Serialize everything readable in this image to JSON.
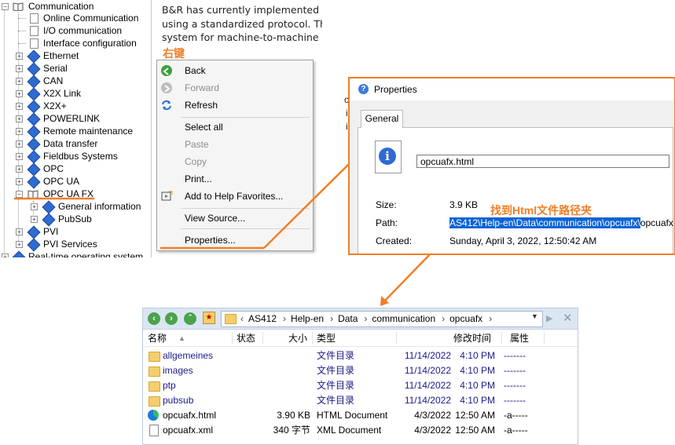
{
  "tree": {
    "root": "Communication",
    "items": [
      {
        "label": "Online Communication",
        "kind": "doc",
        "depth": 1
      },
      {
        "label": "I/O communication",
        "kind": "doc",
        "depth": 1
      },
      {
        "label": "Interface configuration",
        "kind": "doc",
        "depth": 1
      },
      {
        "label": "Ethernet",
        "kind": "folder",
        "depth": 1
      },
      {
        "label": "Serial",
        "kind": "folder",
        "depth": 1
      },
      {
        "label": "CAN",
        "kind": "folder",
        "depth": 1
      },
      {
        "label": "X2X Link",
        "kind": "folder",
        "depth": 1
      },
      {
        "label": "X2X+",
        "kind": "folder",
        "depth": 1
      },
      {
        "label": "POWERLINK",
        "kind": "folder",
        "depth": 1
      },
      {
        "label": "Remote maintenance",
        "kind": "folder",
        "depth": 1
      },
      {
        "label": "Data transfer",
        "kind": "folder",
        "depth": 1
      },
      {
        "label": "Fieldbus Systems",
        "kind": "folder",
        "depth": 1
      },
      {
        "label": "OPC",
        "kind": "folder",
        "depth": 1
      },
      {
        "label": "OPC UA",
        "kind": "folder",
        "depth": 1
      },
      {
        "label": "OPC UA FX",
        "kind": "open",
        "depth": 1
      },
      {
        "label": "General information",
        "kind": "folder",
        "depth": 2
      },
      {
        "label": "PubSub",
        "kind": "folder",
        "depth": 2
      },
      {
        "label": "PVI",
        "kind": "folder",
        "depth": 1
      },
      {
        "label": "PVI Services",
        "kind": "folder",
        "depth": 1
      },
      {
        "label": "Real-time operating system",
        "kind": "folder",
        "depth": 0
      }
    ]
  },
  "intro": {
    "line1": "B&R has currently implemented th",
    "line2": "using a standardized protocol. Th",
    "line3": "system for machine-to-machine c"
  },
  "annotations": {
    "right_click": "右键",
    "find_path": "找到Html文件路径夹"
  },
  "context_menu": {
    "back": "Back",
    "forward": "Forward",
    "refresh": "Refresh",
    "select_all": "Select all",
    "paste": "Paste",
    "copy": "Copy",
    "print": "Print...",
    "add_favorites": "Add to Help Favorites...",
    "view_source": "View Source...",
    "properties": "Properties..."
  },
  "behind_text": {
    "c1": "c",
    "c2": "i",
    "c3": "i"
  },
  "properties": {
    "title": "Properties",
    "tab": "General",
    "filename": "opcuafx.html",
    "size_label": "Size:",
    "size_value": "3.9 KB",
    "path_label": "Path:",
    "path_selected": "AS412\\Help-en\\Data\\communication\\opcuafx\\",
    "path_rest": "opcuafx.html",
    "created_label": "Created:",
    "created_value": "Sunday, April 3, 2022, 12:50:42 AM"
  },
  "explorer": {
    "breadcrumb": [
      "AS412",
      "Help-en",
      "Data",
      "communication",
      "opcuafx"
    ],
    "columns": {
      "name": "名称",
      "status": "状态",
      "size": "大小",
      "type": "类型",
      "modified": "修改时间",
      "attr": "属性"
    },
    "files": [
      {
        "name": "allgemeines",
        "size": "",
        "type": "文件目录",
        "date": "11/14/2022",
        "time": "4:10 PM",
        "attr": "-------",
        "kind": "folder"
      },
      {
        "name": "images",
        "size": "",
        "type": "文件目录",
        "date": "11/14/2022",
        "time": "4:10 PM",
        "attr": "-------",
        "kind": "folder"
      },
      {
        "name": "ptp",
        "size": "",
        "type": "文件目录",
        "date": "11/14/2022",
        "time": "4:10 PM",
        "attr": "-------",
        "kind": "folder"
      },
      {
        "name": "pubsub",
        "size": "",
        "type": "文件目录",
        "date": "11/14/2022",
        "time": "4:10 PM",
        "attr": "-------",
        "kind": "folder"
      },
      {
        "name": "opcuafx.html",
        "size": "3.90 KB",
        "type": "HTML Document",
        "date": "4/3/2022",
        "time": "12:50 AM",
        "attr": "-a-----",
        "kind": "html"
      },
      {
        "name": "opcuafx.xml",
        "size": "340 字节",
        "type": "XML Document",
        "date": "4/3/2022",
        "time": "12:50 AM",
        "attr": "-a-----",
        "kind": "xml"
      }
    ]
  },
  "colors": {
    "accent": "#f07e26",
    "selection": "#0a64d6",
    "link_blue": "#1a1a8c"
  }
}
